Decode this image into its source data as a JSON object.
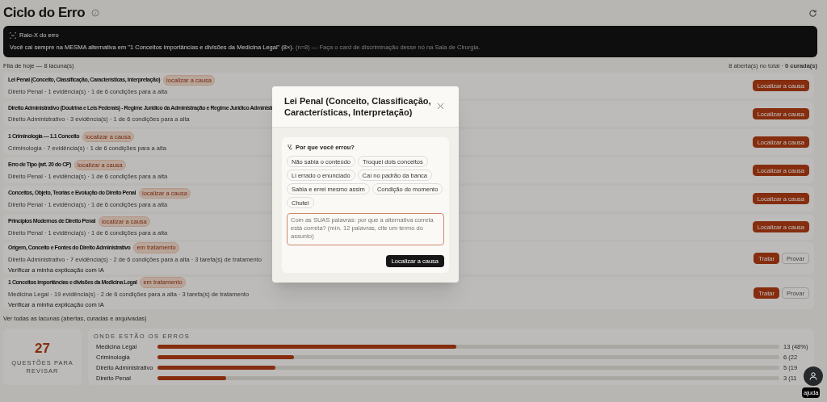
{
  "page": {
    "title": "Ciclo do Erro"
  },
  "banner": {
    "title": "Raio-X do erro",
    "message": "Você cai sempre na MESMA alternativa em \"1 Conceitos importâncias e divisões da Medicina Legal\" (8×).",
    "hint": "(n=8) — Faça o card de discriminação desse nó na Sala de Cirurgia."
  },
  "queue": {
    "label": "Fila de hoje — 8 lacuna(s)",
    "totals": "8 aberta(s) no total · **0 curada(s)**",
    "rows": [
      {
        "title": "Lei Penal (Conceito, Classificação, Características, Interpretação)",
        "badge": "localizar a causa",
        "meta": "Direito Penal · 1 evidência(s) · 1 de 6 condições para a alta",
        "buttons": [
          {
            "label": "Localizar a causa",
            "kind": "primary"
          }
        ]
      },
      {
        "title": "Direito Administrativo (Doutrina e Leis Federais) - Regime Jurídico da Administração e Regime Jurídico Administr",
        "meta": "Direito Administrativo · 3 evidência(s) · 1 de 6 condições para a alta",
        "buttons": [
          {
            "label": "Localizar a causa",
            "kind": "primary"
          }
        ]
      },
      {
        "title": "1 Criminologia — 1.1 Conceito",
        "badge": "localizar a causa",
        "meta": "Criminologia · 7 evidência(s) · 1 de 6 condições para a alta",
        "buttons": [
          {
            "label": "Localizar a causa",
            "kind": "primary"
          }
        ]
      },
      {
        "title": "Erro de Tipo (art. 20 do CP)",
        "badge": "localizar a causa",
        "meta": "Direito Penal · 1 evidência(s) · 1 de 6 condições para a alta",
        "buttons": [
          {
            "label": "Localizar a causa",
            "kind": "primary"
          }
        ]
      },
      {
        "title": "Conceitos, Objeto, Teorias e Evolução do Direito Penal",
        "badge": "localizar a causa",
        "meta": "Direito Penal · 1 evidência(s) · 1 de 6 condições para a alta",
        "buttons": [
          {
            "label": "Localizar a causa",
            "kind": "primary"
          }
        ]
      },
      {
        "title": "Princípios Modernos de Direito Penal",
        "badge": "localizar a causa",
        "meta": "Direito Penal · 1 evidência(s) · 1 de 6 condições para a alta",
        "buttons": [
          {
            "label": "Localizar a causa",
            "kind": "primary"
          }
        ]
      },
      {
        "title": "Origem, Conceito e Fontes do Direito Administrativo",
        "badge": "em tratamento",
        "meta": "Direito Administrativo · 7 evidência(s) · 2 de 6 condições para a alta · 3 tarefa(s) de tratamento",
        "link": "Verificar a minha explicação com IA",
        "buttons": [
          {
            "label": "Tratar",
            "kind": "primary"
          },
          {
            "label": "Provar",
            "kind": "secondary"
          }
        ]
      },
      {
        "title": "1 Conceitos importâncias e divisões da Medicina Legal",
        "badge": "em tratamento",
        "meta": "Medicina Legal · 19 evidência(s) · 2 de 6 condições para a alta · 3 tarefa(s) de tratamento",
        "link": "Verificar a minha explicação com IA",
        "buttons": [
          {
            "label": "Tratar",
            "kind": "primary"
          },
          {
            "label": "Provar",
            "kind": "secondary"
          }
        ]
      }
    ],
    "all_link": "Ver todas as lacunas (abertas, curadas e arquivadas)"
  },
  "stats": {
    "value": "27",
    "label": "QUESTÕES PARA REVISAR"
  },
  "breakdown": {
    "title": "ONDE ESTÃO OS ERROS",
    "items": [
      {
        "name": "Medicina Legal",
        "level": 0.48,
        "reading": "13 (48%)"
      },
      {
        "name": "Criminologia",
        "level": 0.22,
        "reading": "6 (22"
      },
      {
        "name": "Direito Administrativo",
        "level": 0.19,
        "reading": "5 (19"
      },
      {
        "name": "Direito Penal",
        "level": 0.11,
        "reading": "3 (11"
      }
    ]
  },
  "help": {
    "label": "ajuda"
  },
  "modal": {
    "title": "Lei Penal (Conceito, Classificação, Características, Interpretação)",
    "question": "Por que você errou?",
    "reasons": [
      "Não sabia o conteúdo",
      "Troquei dois conceitos",
      "Li errado o enunciado",
      "Caí no padrão da banca",
      "Sabia e errei mesmo assim",
      "Condição do momento",
      "Chutei"
    ],
    "placeholder": "Com as SUAS palavras: por que a alternativa correta está correta? (mín. 12 palavras, cite um termo do assunto)",
    "submit": "Localizar a causa"
  }
}
